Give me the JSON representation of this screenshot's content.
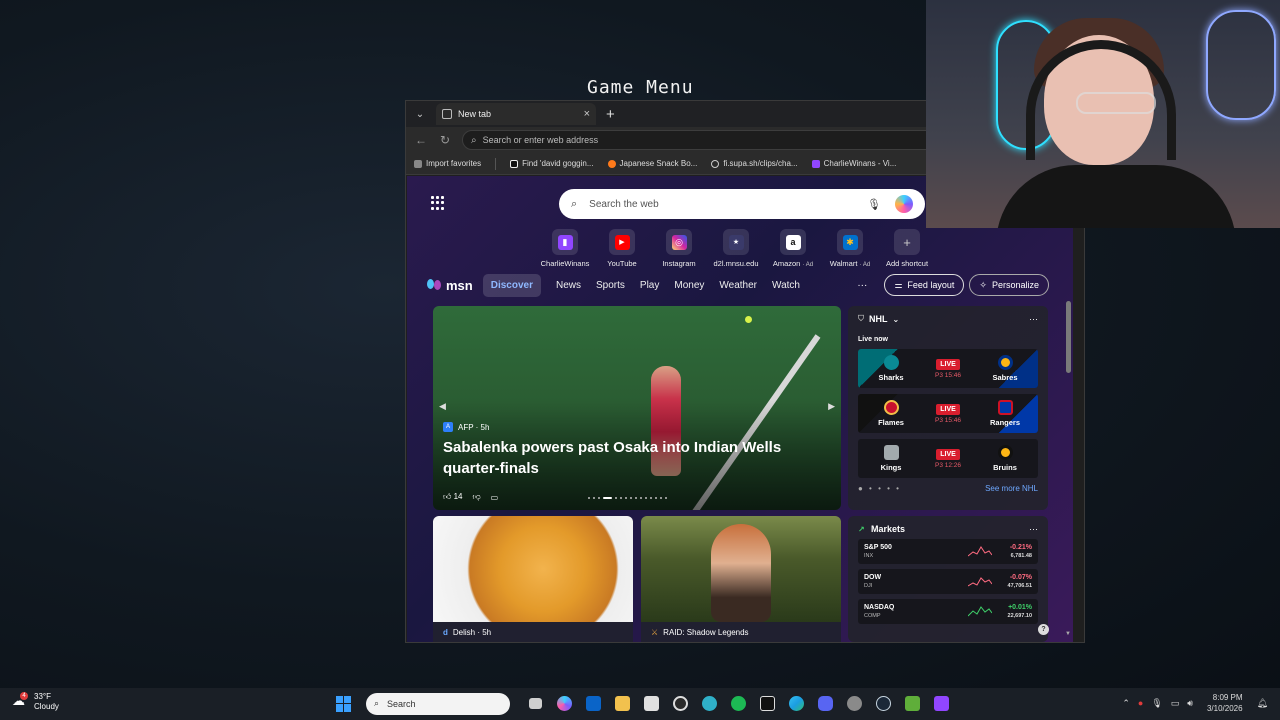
{
  "overlay": {
    "game_menu_label": "Game Menu"
  },
  "browser": {
    "tab": {
      "title": "New tab",
      "close_glyph": "×",
      "new_tab_glyph": "+"
    },
    "address": {
      "placeholder": "Search or enter web address"
    },
    "bookmarks": [
      {
        "label": "Import favorites",
        "icon": "import-icon",
        "color": "#cccccc"
      },
      {
        "label": "Find 'david goggin...",
        "icon": "tiktok-icon",
        "color": "#111111"
      },
      {
        "label": "Japanese Snack Bo...",
        "icon": "snack-icon",
        "color": "#ff7a1a"
      },
      {
        "label": "fi.supa.sh/clips/cha...",
        "icon": "globe-icon",
        "color": "#888888"
      },
      {
        "label": "CharlieWinans - Vi...",
        "icon": "twitch-icon",
        "color": "#9146ff"
      }
    ]
  },
  "newtab": {
    "search_placeholder": "Search the web",
    "shortcuts": [
      {
        "label": "CharlieWinans",
        "ad": "",
        "glyph": "▮",
        "color": "#9146ff"
      },
      {
        "label": "YouTube",
        "ad": "",
        "glyph": "▶",
        "color": "#ff0000"
      },
      {
        "label": "Instagram",
        "ad": "",
        "glyph": "◎",
        "color": "#d6249f"
      },
      {
        "label": "d2l.mnsu.edu",
        "ad": "",
        "glyph": "★",
        "color": "#3a3a6a"
      },
      {
        "label": "Amazon",
        "ad": "· Ad",
        "glyph": "a",
        "color": "#ffffff"
      },
      {
        "label": "Walmart",
        "ad": "· Ad",
        "glyph": "✱",
        "color": "#0071ce"
      },
      {
        "label": "Add shortcut",
        "ad": "",
        "glyph": "+",
        "color": "transparent"
      }
    ]
  },
  "feed": {
    "brand": "msn",
    "tabs": [
      "Discover",
      "News",
      "Sports",
      "Play",
      "Money",
      "Weather",
      "Watch"
    ],
    "more": "···",
    "feed_layout_label": "Feed layout",
    "personalize_label": "Personalize",
    "hero": {
      "source": "AFP · 5h",
      "title": "Sabalenka powers past Osaka into Indian Wells quarter-finals",
      "likes": "14"
    },
    "cards": [
      {
        "source": "Delish · 5h"
      },
      {
        "source": "RAID: Shadow Legends"
      }
    ]
  },
  "nhl": {
    "title": "NHL",
    "live_now": "Live now",
    "games": [
      {
        "home": "Sharks",
        "away": "Sabres",
        "status": "LIVE",
        "period": "P3 15:46",
        "home_color": "#006d75",
        "away_color": "#003087"
      },
      {
        "home": "Flames",
        "away": "Rangers",
        "status": "LIVE",
        "period": "P3 15:46",
        "home_color": "#c8102e",
        "away_color": "#0038a8"
      },
      {
        "home": "Kings",
        "away": "Bruins",
        "status": "LIVE",
        "period": "P3 12:26",
        "home_color": "#a2aaad",
        "away_color": "#fcb514"
      }
    ],
    "see_more": "See more NHL"
  },
  "markets": {
    "title": "Markets",
    "rows": [
      {
        "name": "S&P 500",
        "ticker": "INX",
        "change": "-0.21%",
        "value": "6,781.48",
        "trend": "neg"
      },
      {
        "name": "DOW",
        "ticker": "DJI",
        "change": "-0.07%",
        "value": "47,706.51",
        "trend": "neg"
      },
      {
        "name": "NASDAQ",
        "ticker": "COMP",
        "change": "+0.01%",
        "value": "22,697.10",
        "trend": "pos"
      }
    ]
  },
  "taskbar": {
    "weather_temp": "33°F",
    "weather_desc": "Cloudy",
    "weather_badge": "4",
    "search_label": "Search",
    "time": "8:09 PM",
    "date": "3/10/2026",
    "apps": [
      {
        "name": "task-view",
        "color": "#cfcfcf"
      },
      {
        "name": "copilot",
        "color": "#7b5cff"
      },
      {
        "name": "outlook",
        "color": "#0a64c8"
      },
      {
        "name": "file-explorer",
        "color": "#f2c14e"
      },
      {
        "name": "store",
        "color": "#e0e0e0"
      },
      {
        "name": "obs",
        "color": "#2a2a2a"
      },
      {
        "name": "edge-dev",
        "color": "#2fb0c8"
      },
      {
        "name": "spotify",
        "color": "#1db954"
      },
      {
        "name": "capcut",
        "color": "#111111"
      },
      {
        "name": "edge",
        "color": "#1b9de2"
      },
      {
        "name": "discord",
        "color": "#5865f2"
      },
      {
        "name": "settings",
        "color": "#8a8a8a"
      },
      {
        "name": "steam",
        "color": "#1b2838"
      },
      {
        "name": "minecraft",
        "color": "#5fae3a"
      },
      {
        "name": "twitch",
        "color": "#9146ff"
      }
    ]
  }
}
